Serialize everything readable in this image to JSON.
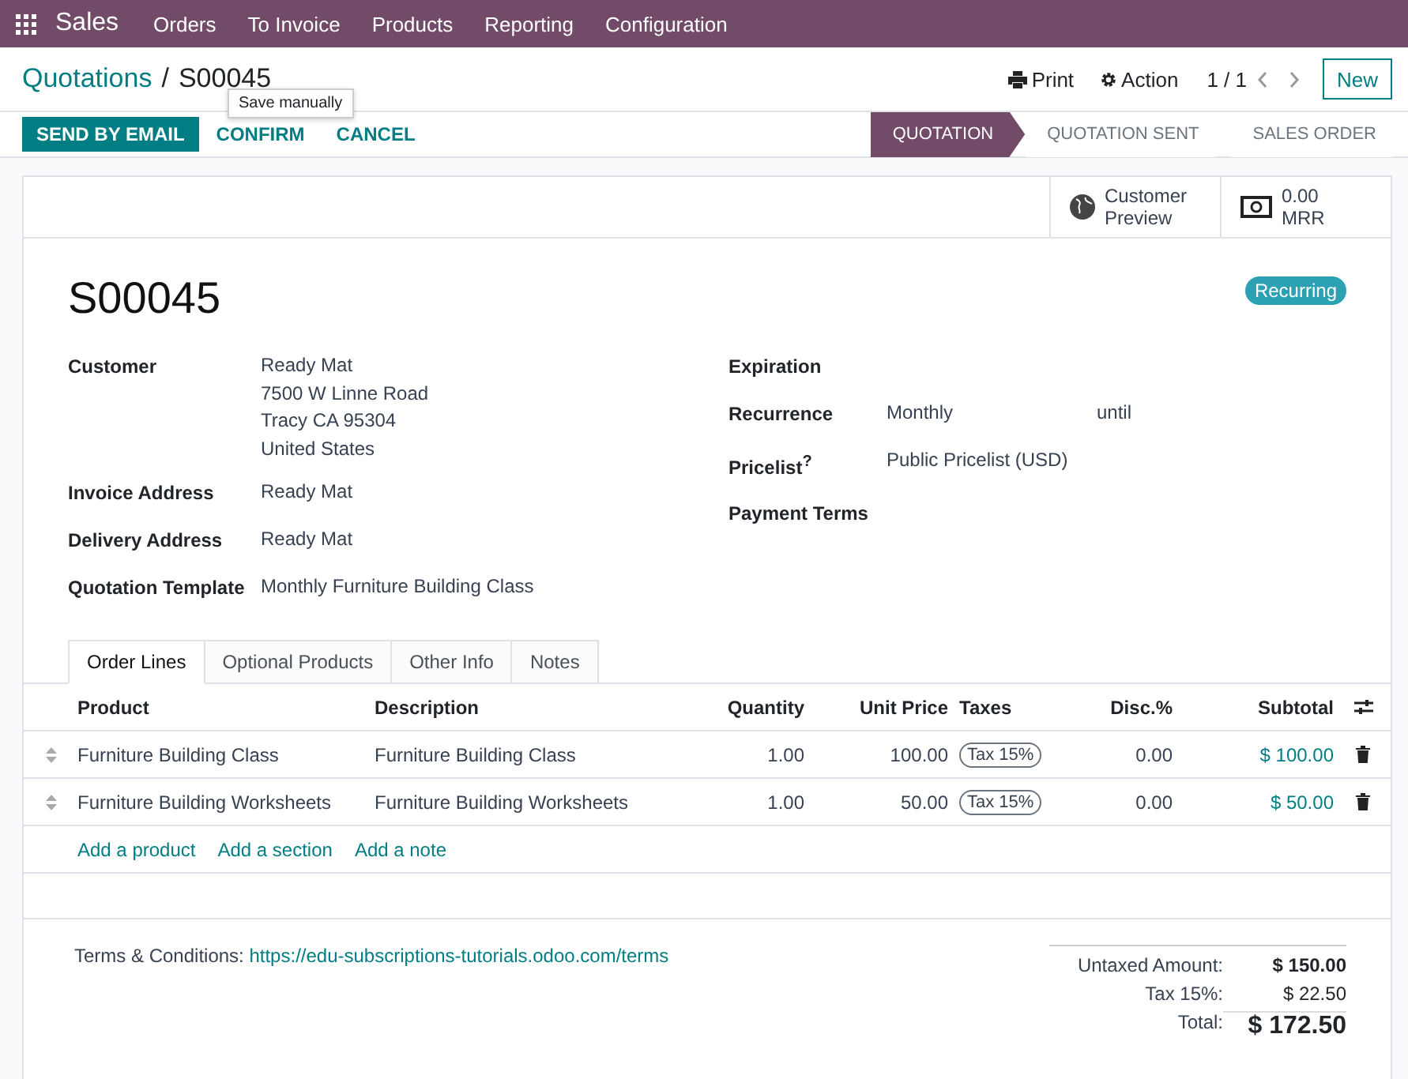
{
  "navbar": {
    "app": "Sales",
    "menus": [
      "Orders",
      "To Invoice",
      "Products",
      "Reporting",
      "Configuration"
    ]
  },
  "breadcrumb": {
    "parent": "Quotations",
    "separator": "/",
    "current": "S00045"
  },
  "control_panel": {
    "print": "Print",
    "action": "Action",
    "pager": "1 / 1",
    "new": "New"
  },
  "tooltip": "Save manually",
  "actions": [
    {
      "label": "SEND BY EMAIL",
      "primary": true
    },
    {
      "label": "CONFIRM",
      "primary": false
    },
    {
      "label": "CANCEL",
      "primary": false
    }
  ],
  "status_steps": [
    {
      "label": "QUOTATION",
      "selected": true
    },
    {
      "label": "QUOTATION SENT",
      "selected": false
    },
    {
      "label": "SALES ORDER",
      "selected": false
    }
  ],
  "smart_buttons": [
    {
      "kind": "preview",
      "lines": [
        "Customer",
        "Preview"
      ]
    },
    {
      "kind": "money",
      "lines": [
        "0.00",
        "MRR"
      ]
    }
  ],
  "title": "S00045",
  "badge": "Recurring",
  "left_fields": [
    {
      "label": "Customer",
      "values": [
        "Ready Mat",
        "7500 W Linne Road",
        "Tracy CA 95304",
        "United States"
      ]
    },
    {
      "label": "Invoice Address",
      "values": [
        "Ready Mat"
      ]
    },
    {
      "label": "Delivery Address",
      "values": [
        "Ready Mat"
      ]
    },
    {
      "label": "Quotation Template",
      "values": [
        "Monthly Furniture Building Class"
      ]
    }
  ],
  "right_fields": [
    {
      "label": "Expiration"
    },
    {
      "label": "Recurrence",
      "values": [
        "Monthly",
        "until"
      ]
    },
    {
      "label": "Pricelist$^{?}$",
      "values": [
        "Public Pricelist (USD)"
      ]
    },
    {
      "label": "Payment Terms"
    }
  ],
  "tabs": [
    {
      "label": "Order Lines",
      "selected": true
    },
    {
      "label": "Optional Products",
      "selected": false
    },
    {
      "label": "Other Info",
      "selected": false
    },
    {
      "label": "Notes",
      "selected": false
    }
  ],
  "table": {
    "columns": [
      "Product",
      "Description",
      "Quantity",
      "Unit Price",
      "Taxes",
      "Disc.%",
      "Subtotal"
    ],
    "rows": [
      {
        "product": "Furniture Building Class",
        "description": "Furniture Building Class",
        "quantity": "1.00",
        "unit_price": "100.00",
        "tax": "Tax 15%",
        "discount": "0.00",
        "subtotal": "$ 100.00"
      },
      {
        "product": "Furniture Building Worksheets",
        "description": "Furniture Building Worksheets",
        "quantity": "1.00",
        "unit_price": "50.00",
        "tax": "Tax 15%",
        "discount": "0.00",
        "subtotal": "$ 50.00"
      }
    ],
    "add_links": [
      "Add a product",
      "Add a section",
      "Add a note"
    ]
  },
  "terms": {
    "label": "Terms & Conditions:",
    "link": "https://edu-subscriptions-tutorials.odoo.com/terms"
  },
  "totals": [
    {
      "kind": "subtotal",
      "label": "Untaxed Amount:",
      "value": "$ 150.00"
    },
    {
      "kind": "tax",
      "label": "Tax 15%:",
      "value": "$ 22.50"
    },
    {
      "kind": "total",
      "label": "Total:",
      "value": "$ 172.50"
    }
  ]
}
